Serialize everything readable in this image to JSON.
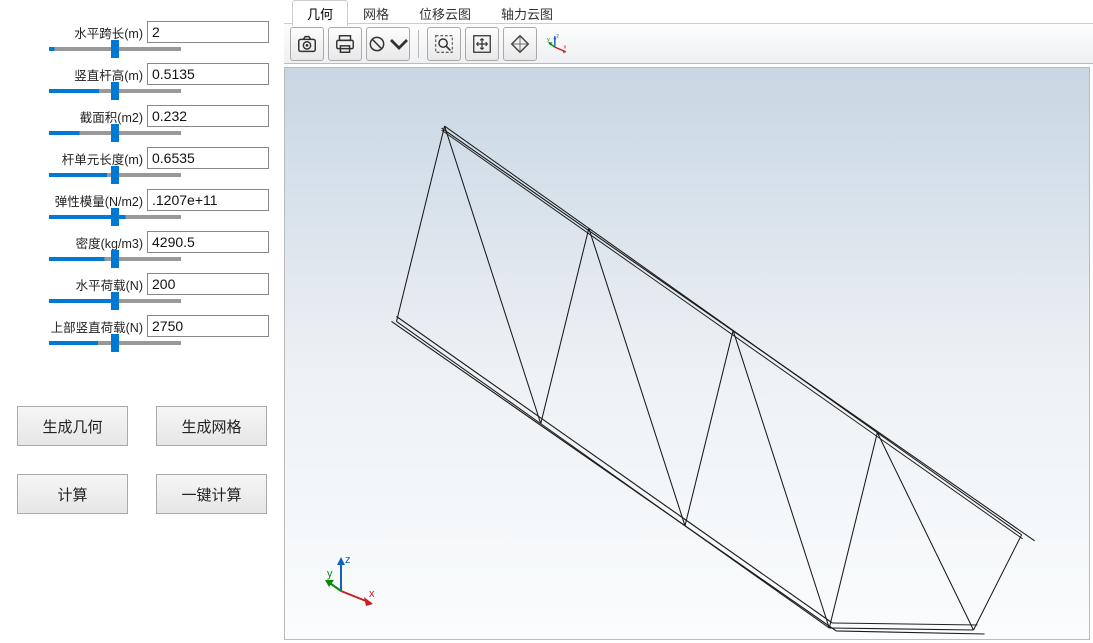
{
  "params": {
    "span": {
      "label": "水平跨长(m)",
      "value": "2",
      "pct": 4
    },
    "vert": {
      "label": "竖直杆高(m)",
      "value": "0.5135",
      "pct": 38
    },
    "area": {
      "label": "截面积(m2)",
      "value": "0.232",
      "pct": 23
    },
    "elemLen": {
      "label": "杆单元长度(m)",
      "value": "0.6535",
      "pct": 44
    },
    "modulus": {
      "label": "弹性模量(N/m2)",
      "value": ".1207e+11",
      "pct": 58
    },
    "density": {
      "label": "密度(kg/m3)",
      "value": "4290.5",
      "pct": 42
    },
    "hLoad": {
      "label": "水平荷载(N)",
      "value": "200",
      "pct": 52
    },
    "vLoad": {
      "label": "上部竖直荷载(N)",
      "value": "2750",
      "pct": 37
    }
  },
  "buttons": {
    "genGeom": "生成几何",
    "genMesh": "生成网格",
    "compute": "计算",
    "oneClick": "一键计算"
  },
  "tabs": {
    "geom": "几何",
    "mesh": "网格",
    "dispCloud": "位移云图",
    "forceCloud": "轴力云图"
  },
  "toolbarIcons": {
    "camera": "camera-icon",
    "print": "print-icon",
    "noaccess": "no-access-icon",
    "zoomrect": "zoom-rect-icon",
    "fit": "fit-view-icon",
    "isoview": "iso-view-icon",
    "axes": "axes-icon"
  },
  "triad": {
    "x": "x",
    "y": "y",
    "z": "z"
  }
}
